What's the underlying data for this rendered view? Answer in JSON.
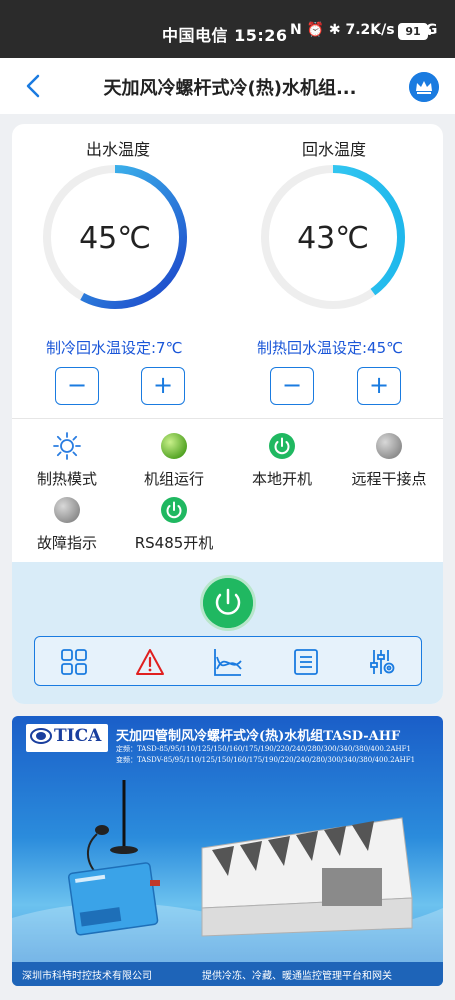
{
  "status_bar": {
    "carrier_time": "中国电信 15:26",
    "indicators": "N ⏰ ✱ 7.2K/s ≋ 5G",
    "battery": "91"
  },
  "header": {
    "title": "天加风冷螺杆式冷(热)水机组...",
    "back_icon": "back-arrow-icon",
    "crown_icon": "crown-icon"
  },
  "gauges": [
    {
      "label": "出水温度",
      "value": "45℃",
      "level": 0.58,
      "setpoint": "制冷回水温设定:7℃"
    },
    {
      "label": "回水温度",
      "value": "43℃",
      "level": 0.4,
      "setpoint": "制热回水温设定:45℃"
    }
  ],
  "steppers": {
    "minus": "−",
    "plus": "+"
  },
  "status_items": [
    {
      "label": "制热模式",
      "icon": "sun-icon",
      "color": "#2a7de1"
    },
    {
      "label": "机组运行",
      "icon": "green-lamp",
      "color": "#7cc23b"
    },
    {
      "label": "本地开机",
      "icon": "power-on-icon",
      "color": "#20b861"
    },
    {
      "label": "远程干接点",
      "icon": "gray-lamp",
      "color": "#9a9a9a"
    },
    {
      "label": "故障指示",
      "icon": "gray-lamp",
      "color": "#9a9a9a"
    },
    {
      "label": "RS485开机",
      "icon": "power-on-icon",
      "color": "#20b861"
    }
  ],
  "toolbar": [
    "grid-icon",
    "alarm-icon",
    "curve-icon",
    "list-icon",
    "settings-sliders-icon"
  ],
  "colors": {
    "accent": "#1a7be0",
    "power": "#20b861",
    "alarm": "#e02020"
  },
  "banner": {
    "logo": "TICA",
    "logo_sub": "天加中央空调",
    "title": "天加四管制风冷螺杆式冷(热)水机组TASD-AHF",
    "line1": "定频：TASD-85/95/110/125/150/160/175/190/220/240/280/300/340/380/400.2AHF1",
    "line2": "变频：TASDV-85/95/110/125/150/160/175/190/220/240/280/300/340/380/400.2AHF1",
    "footer_left": "深圳市科特时控技术有限公司",
    "footer_right": "提供冷冻、冷藏、暖通监控管理平台和网关"
  }
}
